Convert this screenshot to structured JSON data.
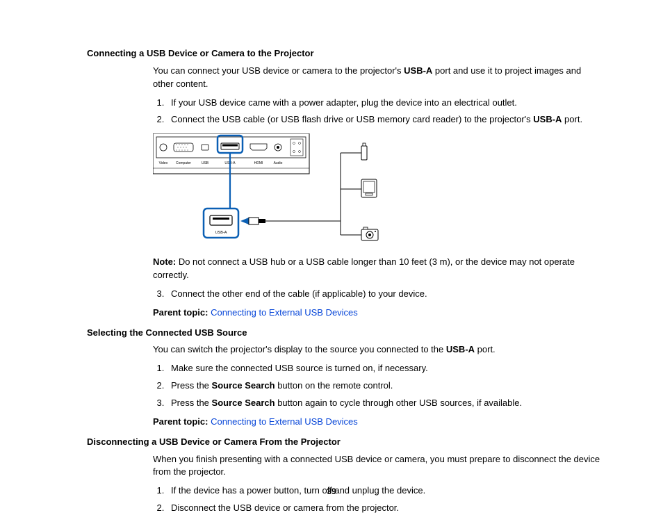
{
  "sections": {
    "connecting": {
      "heading": "Connecting a USB Device or Camera to the Projector",
      "intro_a": "You can connect your USB device or camera to the projector's ",
      "intro_bold": "USB-A",
      "intro_b": " port and use it to project images and other content.",
      "step1": "If your USB device came with a power adapter, plug the device into an electrical outlet.",
      "step2_a": "Connect the USB cable (or USB flash drive or USB memory card reader) to the projector's ",
      "step2_bold": "USB-A",
      "step2_b": " port.",
      "note_label": "Note:",
      "note_text": " Do not connect a USB hub or a USB cable longer than 10 feet (3 m), or the device may not operate correctly.",
      "step3": "Connect the other end of the cable (if applicable) to your device.",
      "parent_label": "Parent topic: ",
      "parent_link": "Connecting to External USB Devices"
    },
    "selecting": {
      "heading": "Selecting the Connected USB Source",
      "intro_a": "You can switch the projector's display to the source you connected to the ",
      "intro_bold": "USB-A",
      "intro_b": " port.",
      "step1": "Make sure the connected USB source is turned on, if necessary.",
      "step2_a": "Press the ",
      "step2_bold": "Source Search",
      "step2_b": " button on the remote control.",
      "step3_a": "Press the ",
      "step3_bold": "Source Search",
      "step3_b": " button again to cycle through other USB sources, if available.",
      "parent_label": "Parent topic: ",
      "parent_link": "Connecting to External USB Devices"
    },
    "disconnecting": {
      "heading": "Disconnecting a USB Device or Camera From the Projector",
      "intro": "When you finish presenting with a connected USB device or camera, you must prepare to disconnect the device from the projector.",
      "step1": "If the device has a power button, turn off and unplug the device.",
      "step2": "Disconnect the USB device or camera from the projector."
    }
  },
  "diagram": {
    "port_labels": [
      "Video",
      "Computer",
      "USB",
      "USB-A",
      "HDMI",
      "Audio"
    ],
    "callout_label": "USB-A"
  },
  "page_number": "39"
}
